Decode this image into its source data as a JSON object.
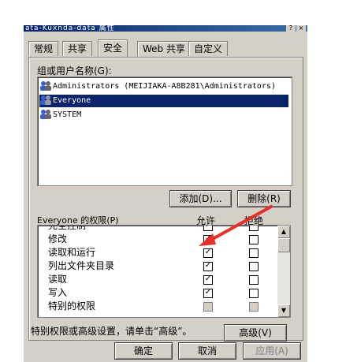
{
  "window": {
    "title": "ata-Kuxnda-data 属性",
    "help_glyph": "?",
    "close_glyph": "×"
  },
  "tabs": [
    {
      "label": "常规"
    },
    {
      "label": "共享"
    },
    {
      "label": "安全",
      "active": true
    },
    {
      "label": "Web 共享"
    },
    {
      "label": "自定义"
    }
  ],
  "security": {
    "group_label": "组或用户名称(G):",
    "users": [
      {
        "name": "Administrators (MEIJIAKA-A8B281\\Administrators)",
        "selected": false
      },
      {
        "name": "Everyone",
        "selected": true
      },
      {
        "name": "SYSTEM",
        "selected": false
      }
    ],
    "add_button": "添加(D)...",
    "remove_button": "删除(R)",
    "perm_title": "Everyone 的权限(P)",
    "allow_header": "允许",
    "deny_header": "拒绝",
    "permissions": [
      {
        "name": "完全控制",
        "allow": true,
        "deny": false
      },
      {
        "name": "修改",
        "allow": true,
        "deny": false
      },
      {
        "name": "读取和运行",
        "allow": true,
        "deny": false
      },
      {
        "name": "列出文件夹目录",
        "allow": true,
        "deny": false
      },
      {
        "name": "读取",
        "allow": true,
        "deny": false
      },
      {
        "name": "写入",
        "allow": true,
        "deny": false
      },
      {
        "name": "特别的权限",
        "allow": false,
        "deny": false,
        "grey": true
      }
    ],
    "advanced_note": "特别权限或高级设置，请单击“高级”。",
    "advanced_button": "高级(V)"
  },
  "footer": {
    "ok": "确定",
    "cancel": "取消",
    "apply": "应用(A)"
  },
  "colors": {
    "face": "#d4d0c8",
    "selection": "#0a246a",
    "annotation_arrow": "#e8302a"
  }
}
